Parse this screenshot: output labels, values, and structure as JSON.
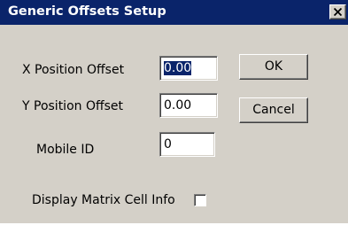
{
  "dialog": {
    "title": "Generic Offsets Setup"
  },
  "fields": {
    "x_offset": {
      "label": "X Position Offset",
      "value": "0.00",
      "selected": true
    },
    "y_offset": {
      "label": "Y Position Offset",
      "value": "0.00"
    },
    "mobile_id": {
      "label": "Mobile ID",
      "value": "0"
    }
  },
  "buttons": {
    "ok": "OK",
    "cancel": "Cancel"
  },
  "checkbox": {
    "label": "Display Matrix Cell Info",
    "checked": false
  },
  "colors": {
    "title_bar": "#0a246a",
    "dialog_bg": "#d4d0c8",
    "selection": "#0a246a"
  },
  "icons": {
    "close": "close-icon"
  }
}
